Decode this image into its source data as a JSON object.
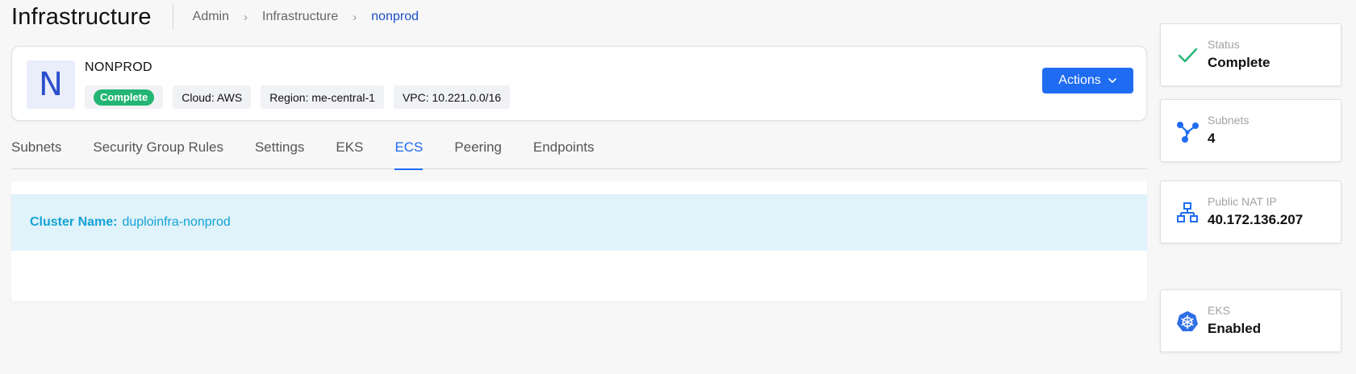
{
  "header": {
    "title": "Infrastructure",
    "breadcrumb": [
      "Admin",
      "Infrastructure",
      "nonprod"
    ]
  },
  "infra": {
    "avatar_letter": "N",
    "name": "NONPROD",
    "status": "Complete",
    "tags": [
      "Cloud: AWS",
      "Region: me-central-1",
      "VPC: 10.221.0.0/16"
    ],
    "actions_label": "Actions"
  },
  "tabs": [
    "Subnets",
    "Security Group Rules",
    "Settings",
    "EKS",
    "ECS",
    "Peering",
    "Endpoints"
  ],
  "active_tab": "ECS",
  "ecs": {
    "cluster_label": "Cluster Name:",
    "cluster_name": "duploinfra-nonprod"
  },
  "stats": [
    {
      "label": "Status",
      "value": "Complete",
      "icon": "check-icon"
    },
    {
      "label": "Subnets",
      "value": "4",
      "icon": "share-nodes-icon"
    },
    {
      "label": "Public NAT IP",
      "value": "40.172.136.207",
      "icon": "network-icon"
    },
    {
      "label": "EKS",
      "value": "Enabled",
      "icon": "kubernetes-icon"
    }
  ],
  "colors": {
    "accent": "#1f6cf2",
    "status_green": "#22b573",
    "banner_bg": "#e0f2fa",
    "banner_text": "#13a3d4",
    "breadcrumb_active": "#1a4fcc"
  }
}
